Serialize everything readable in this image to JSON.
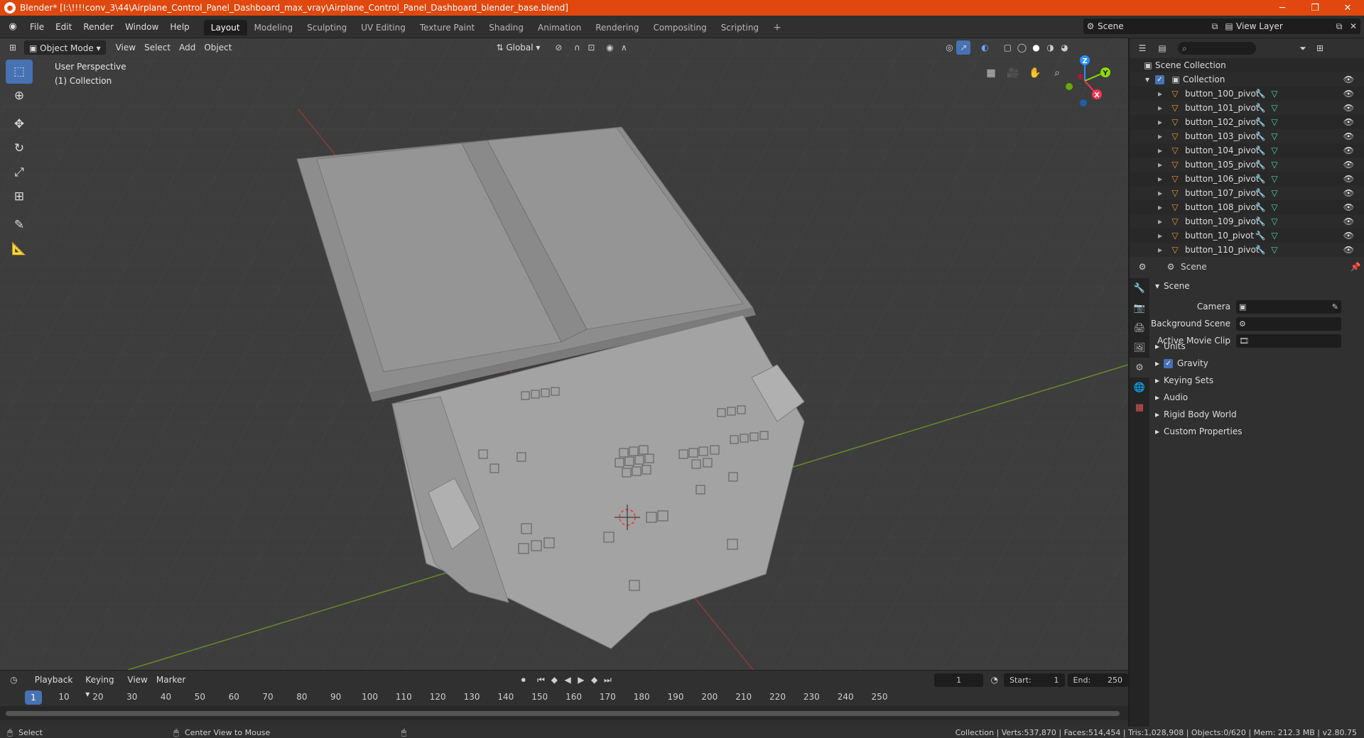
{
  "window": {
    "title": "Blender* [I:\\!!!!conv_3\\44\\Airplane_Control_Panel_Dashboard_max_vray\\Airplane_Control_Panel_Dashboard_blender_base.blend]",
    "minimize": "─",
    "maximize": "❐",
    "close": "✕"
  },
  "menubar": {
    "items": [
      "File",
      "Edit",
      "Render",
      "Window",
      "Help"
    ]
  },
  "workspaces": {
    "tabs": [
      "Layout",
      "Modeling",
      "Sculpting",
      "UV Editing",
      "Texture Paint",
      "Shading",
      "Animation",
      "Rendering",
      "Compositing",
      "Scripting"
    ],
    "active": "Layout",
    "add": "+"
  },
  "scene_selector": {
    "value": "Scene"
  },
  "view_layer_selector": {
    "value": "View Layer"
  },
  "viewport": {
    "mode": "Object Mode",
    "menus": [
      "View",
      "Select",
      "Add",
      "Object"
    ],
    "orientation": "Global",
    "info_line1": "User Perspective",
    "info_line2": "(1) Collection",
    "gizmo": {
      "x": "X",
      "y": "Y",
      "z": "Z"
    }
  },
  "outliner": {
    "root": "Scene Collection",
    "collection": "Collection",
    "items": [
      "button_100_pivot",
      "button_101_pivot",
      "button_102_pivot",
      "button_103_pivot",
      "button_104_pivot",
      "button_105_pivot",
      "button_106_pivot",
      "button_107_pivot",
      "button_108_pivot",
      "button_109_pivot",
      "button_10_pivot",
      "button_110_pivot"
    ]
  },
  "properties": {
    "context": "Scene",
    "panel_title": "Scene",
    "fields": [
      {
        "label": "Camera",
        "value": ""
      },
      {
        "label": "Background Scene",
        "value": ""
      },
      {
        "label": "Active Movie Clip",
        "value": ""
      }
    ],
    "subpanels": [
      "Units",
      "Gravity",
      "Keying Sets",
      "Audio",
      "Rigid Body World",
      "Custom Properties"
    ],
    "gravity_checked": true
  },
  "timeline": {
    "menus": [
      "Playback",
      "Keying",
      "View",
      "Marker"
    ],
    "current_frame": "1",
    "start_label": "Start:",
    "start": "1",
    "end_label": "End:",
    "end": "250",
    "ruler": [
      "1",
      "10",
      "20",
      "30",
      "40",
      "50",
      "60",
      "70",
      "80",
      "90",
      "100",
      "110",
      "120",
      "130",
      "140",
      "150",
      "160",
      "170",
      "180",
      "190",
      "200",
      "210",
      "220",
      "230",
      "240",
      "250"
    ]
  },
  "statusbar": {
    "left": "Select",
    "middle": "Center View to Mouse",
    "stats": "Collection | Verts:537,870 | Faces:514,454 | Tris:1,028,908 | Objects:0/620 | Mem: 212.3 MB | v2.80.75"
  },
  "colors": {
    "titlebar": "#e0480f",
    "accent": "#4772b3",
    "axis_x": "#ff3352",
    "axis_y": "#8bdc00",
    "axis_z": "#2890ff"
  }
}
